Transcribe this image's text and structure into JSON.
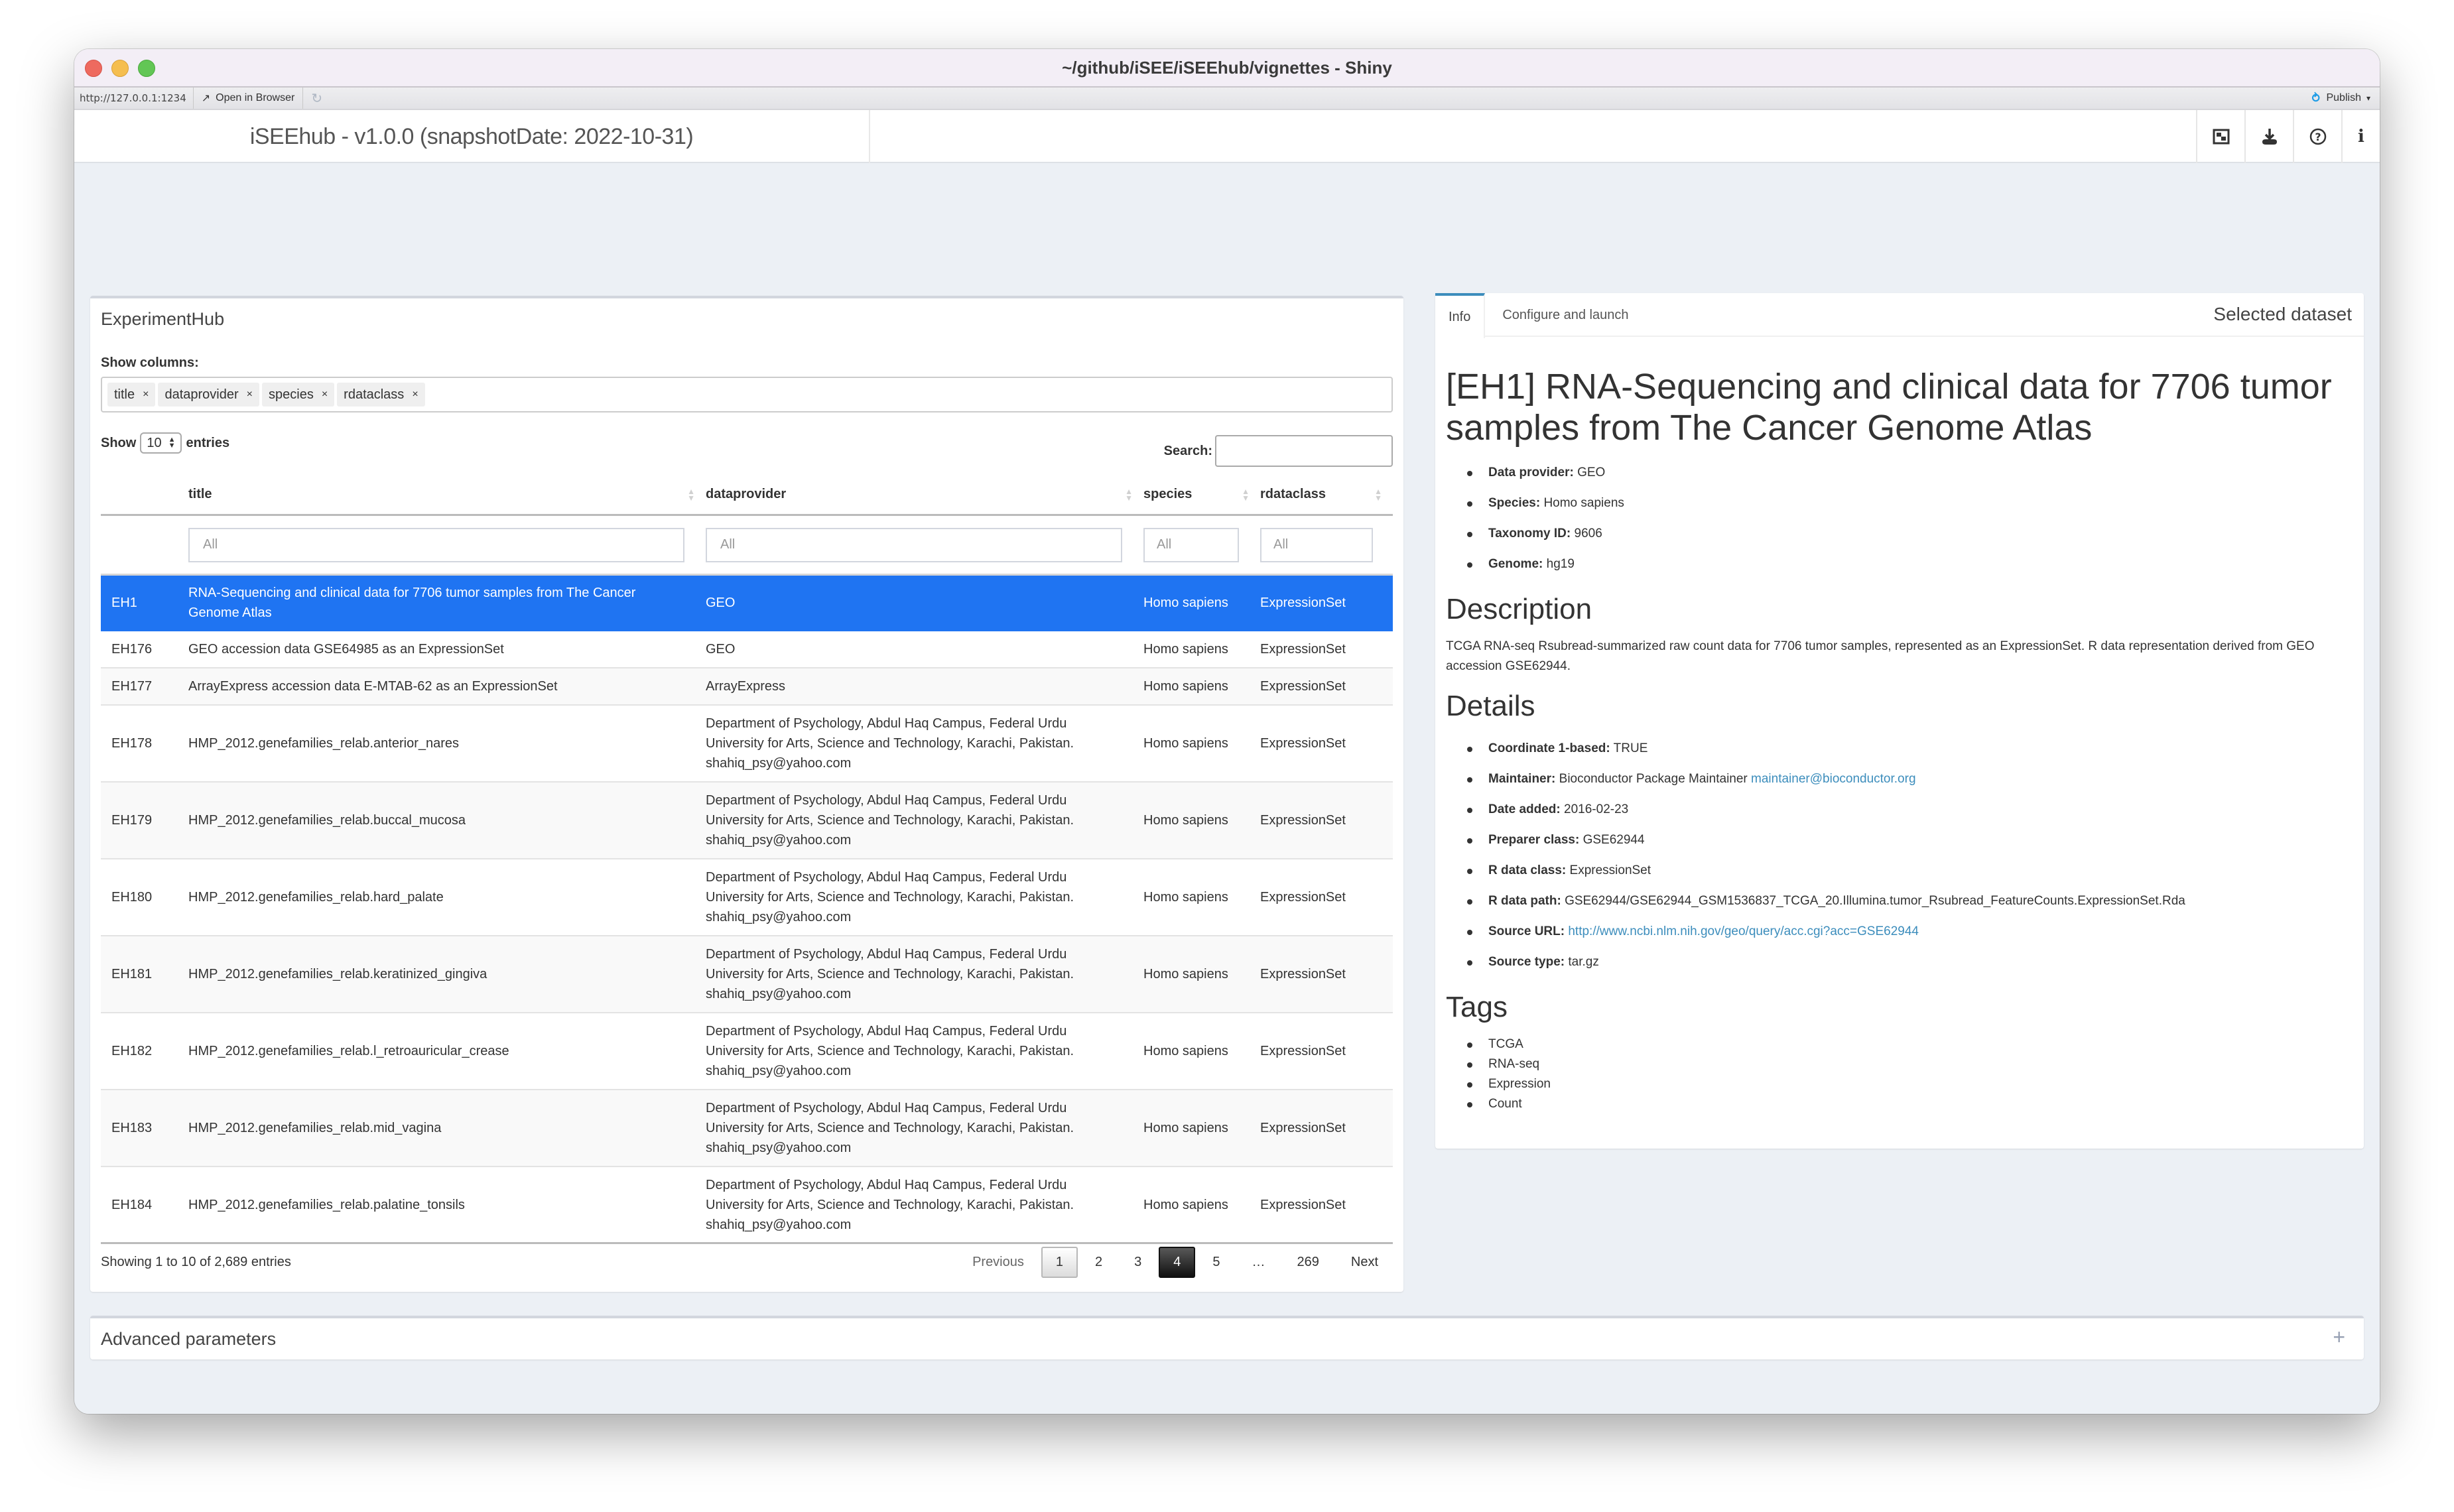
{
  "window": {
    "title": "~/github/iSEE/iSEEhub/vignettes - Shiny",
    "url": "http://127.0.0.1:1234",
    "open_in_browser": "Open in Browser",
    "publish": "Publish"
  },
  "header": {
    "app_title": "iSEEhub - v1.0.0 (snapshotDate: 2022-10-31)",
    "icons": [
      "screenshot-icon",
      "download-icon",
      "help-icon",
      "info-icon"
    ]
  },
  "left_box": {
    "title": "ExperimentHub",
    "show_columns_label": "Show columns:",
    "columns_selected": [
      "title",
      "dataprovider",
      "species",
      "rdataclass"
    ],
    "show_label": "Show",
    "entries_value": "10",
    "entries_label": "entries",
    "search_label": "Search:",
    "search_value": "",
    "table": {
      "headers": [
        "",
        "title",
        "dataprovider",
        "species",
        "rdataclass"
      ],
      "filter_placeholder": "All",
      "rows": [
        {
          "id": "EH1",
          "title": "RNA-Sequencing and clinical data for 7706 tumor samples from The Cancer Genome Atlas",
          "dataprovider": "GEO",
          "species": "Homo sapiens",
          "rdataclass": "ExpressionSet",
          "selected": true
        },
        {
          "id": "EH176",
          "title": "GEO accession data GSE64985 as an ExpressionSet",
          "dataprovider": "GEO",
          "species": "Homo sapiens",
          "rdataclass": "ExpressionSet"
        },
        {
          "id": "EH177",
          "title": "ArrayExpress accession data E-MTAB-62 as an ExpressionSet",
          "dataprovider": "ArrayExpress",
          "species": "Homo sapiens",
          "rdataclass": "ExpressionSet"
        },
        {
          "id": "EH178",
          "title": "HMP_2012.genefamilies_relab.anterior_nares",
          "dataprovider": "Department of Psychology, Abdul Haq Campus, Federal Urdu University for Arts, Science and Technology, Karachi, Pakistan. shahiq_psy@yahoo.com",
          "species": "Homo sapiens",
          "rdataclass": "ExpressionSet"
        },
        {
          "id": "EH179",
          "title": "HMP_2012.genefamilies_relab.buccal_mucosa",
          "dataprovider": "Department of Psychology, Abdul Haq Campus, Federal Urdu University for Arts, Science and Technology, Karachi, Pakistan. shahiq_psy@yahoo.com",
          "species": "Homo sapiens",
          "rdataclass": "ExpressionSet"
        },
        {
          "id": "EH180",
          "title": "HMP_2012.genefamilies_relab.hard_palate",
          "dataprovider": "Department of Psychology, Abdul Haq Campus, Federal Urdu University for Arts, Science and Technology, Karachi, Pakistan. shahiq_psy@yahoo.com",
          "species": "Homo sapiens",
          "rdataclass": "ExpressionSet"
        },
        {
          "id": "EH181",
          "title": "HMP_2012.genefamilies_relab.keratinized_gingiva",
          "dataprovider": "Department of Psychology, Abdul Haq Campus, Federal Urdu University for Arts, Science and Technology, Karachi, Pakistan. shahiq_psy@yahoo.com",
          "species": "Homo sapiens",
          "rdataclass": "ExpressionSet"
        },
        {
          "id": "EH182",
          "title": "HMP_2012.genefamilies_relab.l_retroauricular_crease",
          "dataprovider": "Department of Psychology, Abdul Haq Campus, Federal Urdu University for Arts, Science and Technology, Karachi, Pakistan. shahiq_psy@yahoo.com",
          "species": "Homo sapiens",
          "rdataclass": "ExpressionSet"
        },
        {
          "id": "EH183",
          "title": "HMP_2012.genefamilies_relab.mid_vagina",
          "dataprovider": "Department of Psychology, Abdul Haq Campus, Federal Urdu University for Arts, Science and Technology, Karachi, Pakistan. shahiq_psy@yahoo.com",
          "species": "Homo sapiens",
          "rdataclass": "ExpressionSet"
        },
        {
          "id": "EH184",
          "title": "HMP_2012.genefamilies_relab.palatine_tonsils",
          "dataprovider": "Department of Psychology, Abdul Haq Campus, Federal Urdu University for Arts, Science and Technology, Karachi, Pakistan. shahiq_psy@yahoo.com",
          "species": "Homo sapiens",
          "rdataclass": "ExpressionSet"
        }
      ]
    },
    "info": "Showing 1 to 10 of 2,689 entries",
    "pagination": {
      "previous": "Previous",
      "pages": [
        "1",
        "2",
        "3",
        "4",
        "5",
        "…",
        "269"
      ],
      "active_page": "4",
      "next": "Next"
    }
  },
  "right_box": {
    "tabs": [
      "Info",
      "Configure and launch"
    ],
    "active_tab": "Info",
    "box_title": "Selected dataset",
    "dataset_title": "[EH1] RNA-Sequencing and clinical data for 7706 tumor samples from The Cancer Genome Atlas",
    "summary": [
      {
        "label": "Data provider:",
        "value": "GEO"
      },
      {
        "label": "Species:",
        "value": "Homo sapiens"
      },
      {
        "label": "Taxonomy ID:",
        "value": "9606"
      },
      {
        "label": "Genome:",
        "value": "hg19"
      }
    ],
    "description_heading": "Description",
    "description": "TCGA RNA-seq Rsubread-summarized raw count data for 7706 tumor samples, represented as an ExpressionSet. R data representation derived from GEO accession GSE62944.",
    "details_heading": "Details",
    "details": [
      {
        "label": "Coordinate 1-based:",
        "value": "TRUE"
      },
      {
        "label": "Maintainer:",
        "value": "Bioconductor Package Maintainer",
        "link": "maintainer@bioconductor.org"
      },
      {
        "label": "Date added:",
        "value": "2016-02-23"
      },
      {
        "label": "Preparer class:",
        "value": "GSE62944"
      },
      {
        "label": "R data class:",
        "value": "ExpressionSet"
      },
      {
        "label": "R data path:",
        "value": "GSE62944/GSE62944_GSM1536837_TCGA_20.Illumina.tumor_Rsubread_FeatureCounts.ExpressionSet.Rda"
      },
      {
        "label": "Source URL:",
        "value": "",
        "link": "http://www.ncbi.nlm.nih.gov/geo/query/acc.cgi?acc=GSE62944"
      },
      {
        "label": "Source type:",
        "value": "tar.gz"
      }
    ],
    "tags_heading": "Tags",
    "tags": [
      "TCGA",
      "RNA-seq",
      "Expression",
      "Count"
    ]
  },
  "advanced": {
    "title": "Advanced parameters",
    "expand_icon": "+"
  },
  "colors": {
    "selected_row": "#1f74f2",
    "link": "#3c8dbc",
    "active_page": "#222222",
    "background": "#ecf0f5"
  }
}
